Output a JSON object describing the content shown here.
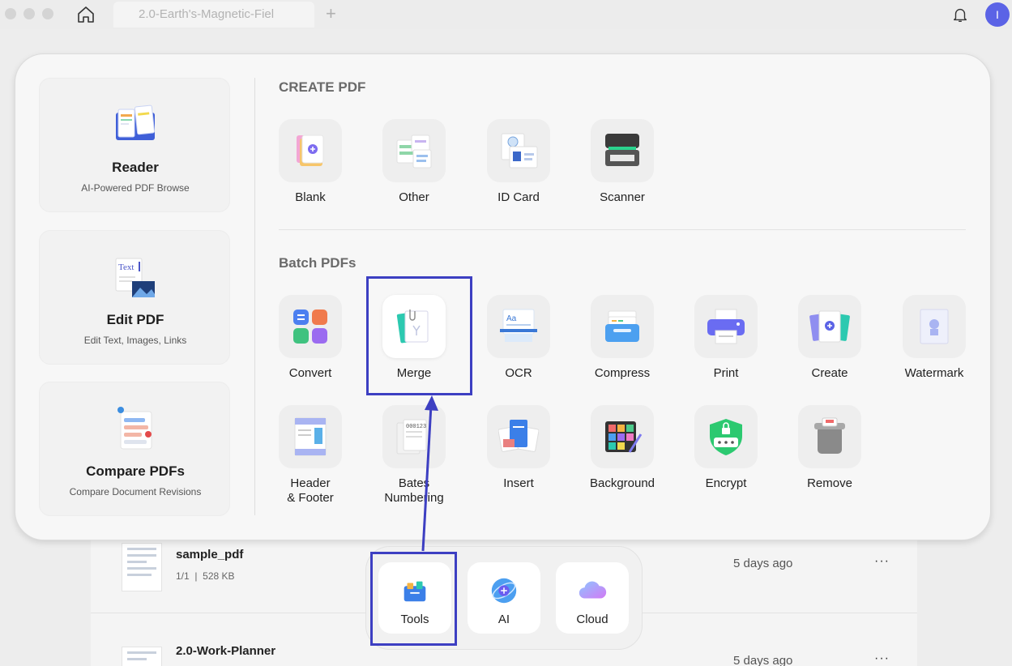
{
  "window": {
    "tab_title": "2.0-Earth's-Magnetic-Fiel",
    "new_tab": "+",
    "avatar_initial": "I"
  },
  "left_panel": [
    {
      "title": "Reader",
      "subtitle": "AI-Powered PDF Browse",
      "icon": "book-icon"
    },
    {
      "title": "Edit PDF",
      "subtitle": "Edit Text, Images, Links",
      "icon": "edit-text-icon"
    },
    {
      "title": "Compare PDFs",
      "subtitle": "Compare Document Revisions",
      "icon": "compare-icon"
    }
  ],
  "create_section": {
    "title": "CREATE PDF",
    "tools": [
      "Blank",
      "Other",
      "ID Card",
      "Scanner"
    ]
  },
  "batch_section": {
    "title": "Batch PDFs",
    "tools_row1": [
      "Convert",
      "Merge",
      "OCR",
      "Compress",
      "Print",
      "Create",
      "Watermark"
    ],
    "tools_row2": [
      "Header\n& Footer",
      "Bates\nNumbering",
      "Insert",
      "Background",
      "Encrypt",
      "Remove"
    ]
  },
  "files": [
    {
      "name": "sample_pdf",
      "pages": "1/1",
      "size": "528 KB",
      "date": "5 days ago",
      "more": "···"
    },
    {
      "name": "2.0-Work-Planner",
      "date": "5 days ago",
      "more": "···"
    }
  ],
  "dock": [
    "Tools",
    "AI",
    "Cloud"
  ],
  "colors": {
    "highlight": "#3d3fc2",
    "accent": "#5b63e6"
  }
}
